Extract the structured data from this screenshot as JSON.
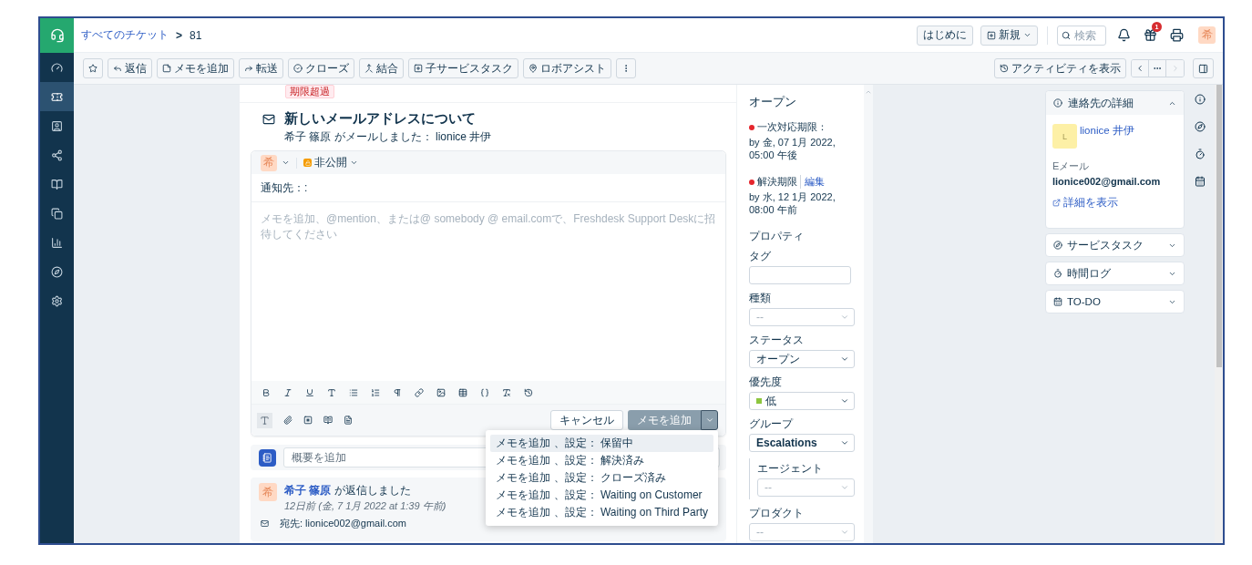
{
  "sidebar": {
    "items": [
      {
        "selected": false
      },
      {
        "selected": true
      },
      {
        "selected": false
      },
      {
        "selected": false
      },
      {
        "selected": false
      },
      {
        "selected": false
      },
      {
        "selected": false
      },
      {
        "selected": false
      },
      {
        "selected": false
      }
    ]
  },
  "breadcrumb": {
    "link": "すべてのチケット",
    "separator": ">",
    "current": "81"
  },
  "header": {
    "getting_started": "はじめに",
    "new": "新規",
    "search_placeholder": "検索",
    "gift_count": "1",
    "avatar": "希"
  },
  "toolbar": {
    "buttons": [
      {
        "kind": "star"
      },
      {
        "kind": "reply",
        "label": "返信"
      },
      {
        "kind": "note",
        "label": "メモを追加"
      },
      {
        "kind": "forward",
        "label": "転送"
      },
      {
        "kind": "close",
        "label": "クローズ"
      },
      {
        "kind": "merge",
        "label": "結合"
      },
      {
        "kind": "task",
        "label": "子サービスタスク"
      },
      {
        "kind": "robo",
        "label": "ロボアシスト"
      },
      {
        "kind": "more"
      }
    ],
    "activity": "アクティビティを表示",
    "prev_disabled": false,
    "next_disabled": true
  },
  "ticket": {
    "overdue_badge": "期限超過",
    "subject": "新しいメールアドレスについて",
    "meta": "希子 篠原 がメールしました： lionice 井伊"
  },
  "editor": {
    "avatar": "希",
    "visibility": "非公開",
    "notify_label": "通知先：:",
    "placeholder": "メモを追加、@mention、または@ somebody @ email.comで、Freshdesk Support Deskに招待してください",
    "text_format_active": true,
    "cancel": "キャンセル",
    "submit": "メモを追加",
    "menu_open": true
  },
  "submit_menu": {
    "items": [
      {
        "label": "メモを追加 、設定： 保留中",
        "selected": true
      },
      {
        "label": "メモを追加 、設定： 解決済み",
        "selected": false
      },
      {
        "label": "メモを追加 、設定： クローズ済み",
        "selected": false
      },
      {
        "label": "メモを追加 、設定： Waiting on Customer",
        "selected": false
      },
      {
        "label": "メモを追加 、設定： Waiting on Third Party",
        "selected": false
      }
    ]
  },
  "summary": {
    "placeholder": "概要を追加"
  },
  "conversation": {
    "avatar": "希",
    "author": "希子 篠原",
    "action": "が返信しました",
    "time": "12日前 (金, 7 1月 2022 at 1:39 午前)",
    "to": "宛先: lionice002@gmail.com"
  },
  "status_panel": {
    "status": "オープン",
    "sla": [
      {
        "label": "一次対応期限：",
        "due": "by 金, 07 1月 2022, 05:00 午後"
      },
      {
        "label": "解決期限",
        "edit": "編集",
        "due": "by 水, 12 1月 2022, 08:00 午前"
      }
    ]
  },
  "properties": {
    "title": "プロパティ",
    "fields": [
      {
        "kind": "text",
        "label": "タグ"
      },
      {
        "kind": "select",
        "label": "種類",
        "placeholder": "--"
      },
      {
        "kind": "select",
        "label": "ステータス",
        "value": "オープン"
      },
      {
        "kind": "select",
        "label": "優先度",
        "value": "低",
        "color": "#8dc63f"
      },
      {
        "kind": "select",
        "label": "グループ",
        "value": "Escalations"
      },
      {
        "kind": "nested",
        "label": "エージェント",
        "placeholder": "--"
      },
      {
        "kind": "select",
        "label": "プロダクト",
        "placeholder": "--"
      }
    ]
  },
  "contact": {
    "title": "連絡先の詳細",
    "expanded": true,
    "avatar": "L",
    "name": "lionice 井伊",
    "email_label": "Eメール",
    "email": "lionice002@gmail.com",
    "details_link": "詳細を表示"
  },
  "widgets": [
    {
      "kind": "task",
      "label": "サービスタスク",
      "expanded": false
    },
    {
      "kind": "time",
      "label": "時間ログ",
      "expanded": false
    },
    {
      "kind": "todo",
      "label": "TO-DO",
      "expanded": false
    }
  ]
}
